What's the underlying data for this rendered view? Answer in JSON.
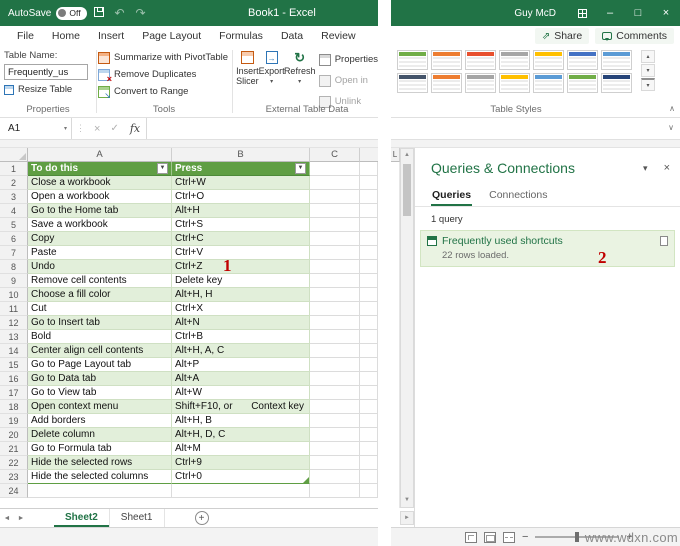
{
  "colors": {
    "titlebar": "#217346",
    "accent": "#217346",
    "table_header": "#5f9e43",
    "band": "#e2efda",
    "annotation": "#c00000"
  },
  "titlebar": {
    "autosave_label": "AutoSave",
    "autosave_state": "Off",
    "title": "Book1 - Excel",
    "user": "Guy McD"
  },
  "ribbon": {
    "tabs": [
      "File",
      "Home",
      "Insert",
      "Page Layout",
      "Formulas",
      "Data",
      "Review"
    ],
    "share_label": "Share",
    "comments_label": "Comments",
    "properties_group": {
      "table_name_label": "Table Name:",
      "table_name_value": "Frequently_us",
      "resize_table_label": "Resize Table",
      "group_label": "Properties"
    },
    "tools_group": {
      "items": [
        "Summarize with PivotTable",
        "Remove Duplicates",
        "Convert to Range"
      ],
      "group_label": "Tools"
    },
    "external_group": {
      "insert_slicer_label": "Insert Slicer",
      "export_label": "Export",
      "refresh_label": "Refresh",
      "properties_label": "Properties",
      "open_in_label": "Open in",
      "unlink_label": "Unlink",
      "group_label": "External Table Data"
    },
    "table_styles_group": {
      "group_label": "Table Styles",
      "row1_headers": [
        "#70ad47",
        "#ed7d31",
        "#e8502e",
        "#a6a6a6",
        "#ffc000",
        "#4472c4",
        "#5b9bd5"
      ],
      "row2_headers": [
        "#44546a",
        "#ed7d31",
        "#a5a5a5",
        "#ffc000",
        "#5b9bd5",
        "#70ad47",
        "#264478"
      ]
    }
  },
  "formula_bar": {
    "name_box": "A1",
    "fx_label": "fx"
  },
  "grid": {
    "columns": [
      "A",
      "B",
      "C"
    ],
    "right_column": "L",
    "header_row": [
      "To do this",
      "Press"
    ],
    "rows": [
      {
        "n": 2,
        "a": "Close a workbook",
        "b": "Ctrl+W"
      },
      {
        "n": 3,
        "a": "Open a workbook",
        "b": "Ctrl+O"
      },
      {
        "n": 4,
        "a": "Go to the Home tab",
        "b": "Alt+H"
      },
      {
        "n": 5,
        "a": "Save a workbook",
        "b": "Ctrl+S"
      },
      {
        "n": 6,
        "a": "Copy",
        "b": "Ctrl+C"
      },
      {
        "n": 7,
        "a": "Paste",
        "b": "Ctrl+V"
      },
      {
        "n": 8,
        "a": "Undo",
        "b": "Ctrl+Z"
      },
      {
        "n": 9,
        "a": "Remove cell contents",
        "b": "Delete key"
      },
      {
        "n": 10,
        "a": "Choose a fill color",
        "b": "Alt+H, H"
      },
      {
        "n": 11,
        "a": "Cut",
        "b": "Ctrl+X"
      },
      {
        "n": 12,
        "a": "Go to Insert tab",
        "b": "Alt+N"
      },
      {
        "n": 13,
        "a": "Bold",
        "b": "Ctrl+B"
      },
      {
        "n": 14,
        "a": "Center align cell contents",
        "b": "Alt+H, A, C"
      },
      {
        "n": 15,
        "a": "Go to Page Layout tab",
        "b": "Alt+P"
      },
      {
        "n": 16,
        "a": "Go to Data tab",
        "b": "Alt+A"
      },
      {
        "n": 17,
        "a": "Go to View tab",
        "b": "Alt+W"
      },
      {
        "n": 18,
        "a": "Open context menu",
        "b": "Shift+F10, or",
        "b2": "Context key"
      },
      {
        "n": 19,
        "a": "Add borders",
        "b": "Alt+H, B"
      },
      {
        "n": 20,
        "a": "Delete column",
        "b": "Alt+H, D, C"
      },
      {
        "n": 21,
        "a": "Go to Formula tab",
        "b": "Alt+M"
      },
      {
        "n": 22,
        "a": "Hide the selected rows",
        "b": "Ctrl+9"
      },
      {
        "n": 23,
        "a": "Hide the selected columns",
        "b": "Ctrl+0"
      },
      {
        "n": 24,
        "a": "",
        "b": ""
      }
    ]
  },
  "sheet_tabs": {
    "sheets": [
      "Sheet2",
      "Sheet1"
    ],
    "active": "Sheet2"
  },
  "queries_pane": {
    "title": "Queries & Connections",
    "tabs": [
      "Queries",
      "Connections"
    ],
    "active_tab": "Queries",
    "summary": "1 query",
    "query_name": "Frequently used shortcuts",
    "query_status": "22 rows loaded."
  },
  "annotations": {
    "grid_marker": "1",
    "pane_marker": "2"
  },
  "watermark": "www.wdxn.com",
  "icons": {
    "undo": "↶",
    "redo": "↷",
    "caret_down": "▾",
    "filter_dropdown": "▼",
    "minimize": "–",
    "maximize": "□",
    "close": "×",
    "share": "⇗",
    "refresh": "↻",
    "formula_cancel": "×",
    "formula_enter": "✓",
    "handle_dots": "⋮",
    "tab_prev": "◄",
    "tab_next": "►",
    "add_sheet": "+",
    "scroll_up": "▲",
    "scroll_down": "▼",
    "scroll_right": "►",
    "gallery_up": "▴",
    "gallery_down": "▾",
    "collapse_ribbon": "∧",
    "expand_formula": "∨",
    "zoom_out": "−",
    "zoom_in": "+"
  }
}
